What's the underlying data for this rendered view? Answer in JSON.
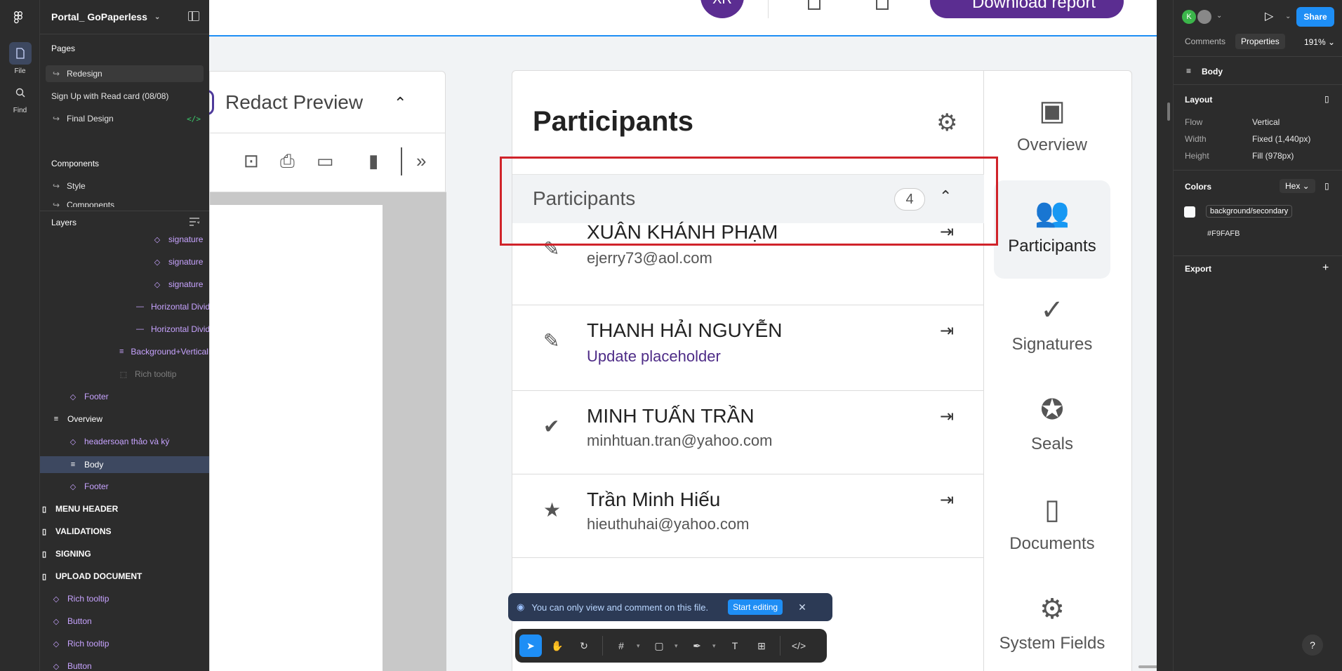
{
  "rail": {
    "file_label": "File",
    "find_label": "Find"
  },
  "left_panel": {
    "project_name": "Portal_ GoPaperless",
    "pages_title": "Pages",
    "pages": [
      {
        "label": "Redesign",
        "selected": true
      },
      {
        "label": "Sign Up with Read card (08/08)"
      },
      {
        "label": "Final Design"
      }
    ],
    "components_title": "Components",
    "components": [
      {
        "label": "Style"
      },
      {
        "label": "Components"
      }
    ],
    "layers_title": "Layers",
    "layers": [
      {
        "label": "signature"
      },
      {
        "label": "signature"
      },
      {
        "label": "signature"
      },
      {
        "label": "Horizontal Divider"
      },
      {
        "label": "Horizontal Divider"
      },
      {
        "label": "Background+VerticalBorder"
      },
      {
        "label": "Rich tooltip"
      },
      {
        "label": "Footer"
      },
      {
        "label": "Overview"
      },
      {
        "label": "headersoạn thảo và ký"
      },
      {
        "label": "Body"
      },
      {
        "label": "Footer"
      },
      {
        "label": "MENU HEADER"
      },
      {
        "label": "VALIDATIONS"
      },
      {
        "label": "SIGNING"
      },
      {
        "label": "UPLOAD DOCUMENT"
      },
      {
        "label": "Rich tooltip"
      },
      {
        "label": "Button"
      },
      {
        "label": "Rich tooltip"
      },
      {
        "label": "Button"
      }
    ]
  },
  "canvas": {
    "avatar_initials": "XR",
    "download_label": "Download report",
    "redact_title": "Redact Preview",
    "participants_title": "Participants",
    "participants_section": "Participants",
    "participants_count": "4",
    "participants": [
      {
        "name": "XUÂN KHÁNH PHẠM",
        "detail": "ejerry73@aol.com",
        "link": false,
        "icon": "user-edit-icon"
      },
      {
        "name": "THANH HẢI NGUYỄN",
        "detail": "Update placeholder",
        "link": true,
        "icon": "user-edit-icon"
      },
      {
        "name": "MINH TUẤN TRẦN",
        "detail": "minhtuan.tran@yahoo.com",
        "link": false,
        "icon": "user-check-icon"
      },
      {
        "name": "Trần Minh Hiếu",
        "detail": "hieuthuhai@yahoo.com",
        "link": false,
        "icon": "user-star-icon"
      }
    ],
    "side_nav": [
      {
        "label": "Overview",
        "icon": "layout-icon",
        "active": false
      },
      {
        "label": "Participants",
        "icon": "users-icon",
        "active": true
      },
      {
        "label": "Signatures",
        "icon": "check-circle-icon",
        "active": false
      },
      {
        "label": "Seals",
        "icon": "award-icon",
        "active": false
      },
      {
        "label": "Documents",
        "icon": "file-icon",
        "active": false
      },
      {
        "label": "System Fields",
        "icon": "gear-icon",
        "active": false
      }
    ],
    "notice_text": "You can only view and comment on this file.",
    "start_editing": "Start editing"
  },
  "right_panel": {
    "avatar_initial": "K",
    "share_label": "Share",
    "tabs": [
      "Comments",
      "Properties"
    ],
    "active_tab": "Properties",
    "zoom": "191%",
    "layer_name": "Body",
    "layout_title": "Layout",
    "flow_label": "Flow",
    "flow_value": "Vertical",
    "width_label": "Width",
    "width_value": "Fixed (1,440px)",
    "height_label": "Height",
    "height_value": "Fill (978px)",
    "colors_title": "Colors",
    "color_mode": "Hex",
    "color_token": "background/secondary",
    "color_hex": "#F9FAFB",
    "export_title": "Export",
    "help": "?"
  },
  "colors": {
    "brand_purple": "#5b2d91",
    "selection_blue": "#1e8ef5",
    "highlight_red": "#d0232a",
    "panel_dark": "#2c2c2c"
  }
}
